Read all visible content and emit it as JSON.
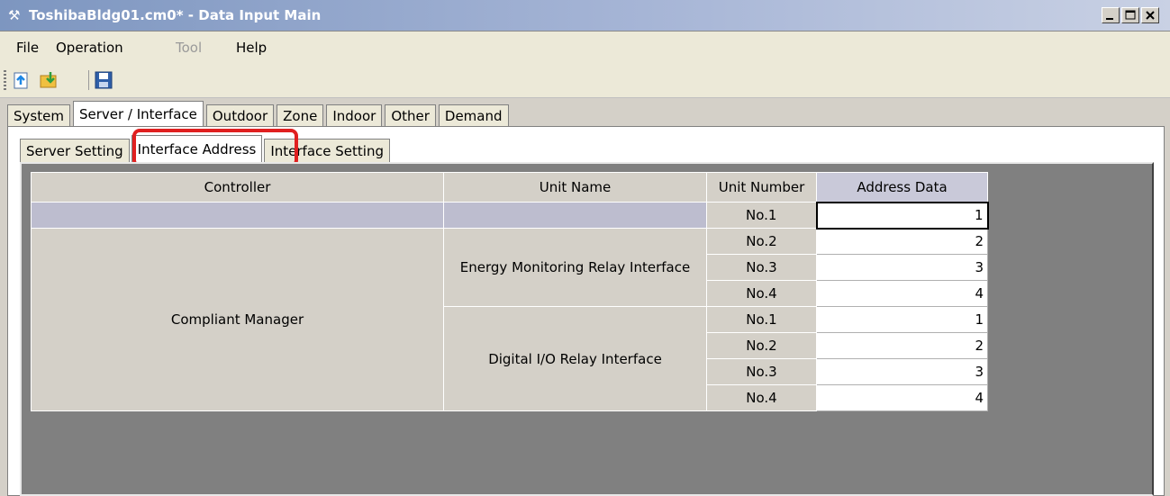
{
  "window": {
    "title": "ToshibaBldg01.cm0* - Data Input Main"
  },
  "menu": [
    {
      "label": "File",
      "disabled": false
    },
    {
      "label": "Operation",
      "disabled": false
    },
    {
      "label": "Tool",
      "disabled": true
    },
    {
      "label": "Help",
      "disabled": false
    }
  ],
  "toolbar": {
    "icons": [
      "open-icon",
      "import-icon",
      "save-icon"
    ]
  },
  "main_tabs": [
    "System",
    "Server / Interface",
    "Outdoor",
    "Zone",
    "Indoor",
    "Other",
    "Demand"
  ],
  "sub_tabs": [
    "Server Setting",
    "Interface Address",
    "Interface Setting"
  ],
  "grid": {
    "headers": {
      "controller": "Controller",
      "unit_name": "Unit Name",
      "unit_number": "Unit Number",
      "address_data": "Address Data"
    },
    "controller": "Compliant Manager",
    "groups": [
      {
        "unit_name": "Energy Monitoring Relay Interface",
        "rows": [
          {
            "num": "No.1",
            "value": "1"
          },
          {
            "num": "No.2",
            "value": "2"
          },
          {
            "num": "No.3",
            "value": "3"
          },
          {
            "num": "No.4",
            "value": "4"
          }
        ]
      },
      {
        "unit_name": "Digital I/O Relay Interface",
        "rows": [
          {
            "num": "No.1",
            "value": "1"
          },
          {
            "num": "No.2",
            "value": "2"
          },
          {
            "num": "No.3",
            "value": "3"
          },
          {
            "num": "No.4",
            "value": "4"
          }
        ]
      }
    ]
  },
  "colors": {
    "highlight": "#e02020",
    "titlebar": "#7d96c0"
  }
}
